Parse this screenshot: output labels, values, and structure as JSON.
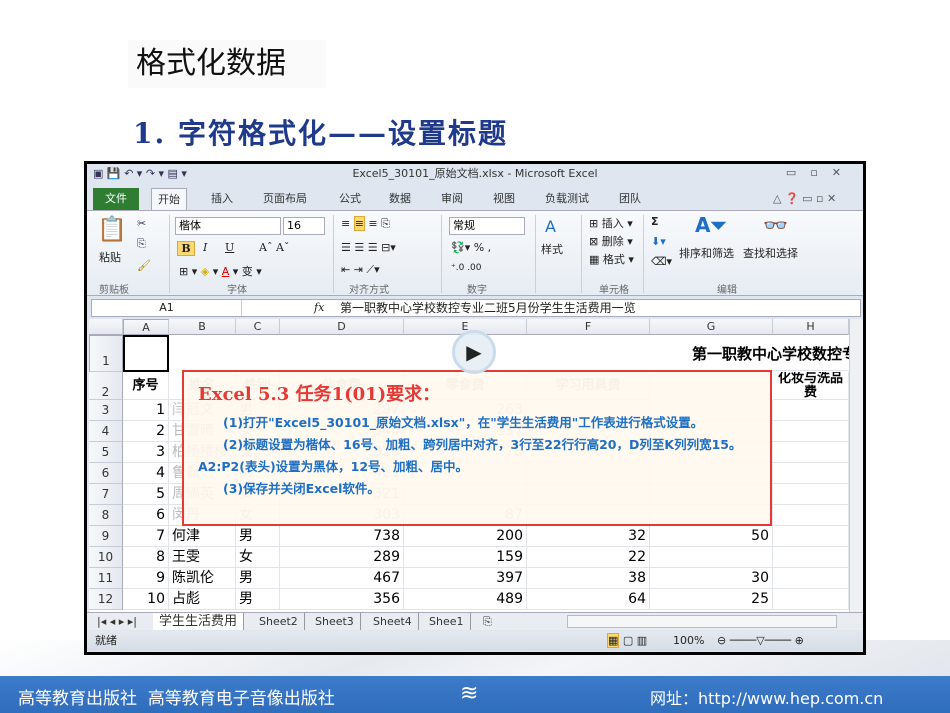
{
  "slide": {
    "title": "格式化数据",
    "subtitle": "1. 字符格式化——设置标题"
  },
  "footer": {
    "publisher_logo": "高等教育出版社",
    "publisher": "高等教育电子音像出版社",
    "website": "网址：http://www.hep.com.cn"
  },
  "excel": {
    "window_title": "Excel5_30101_原始文档.xlsx - Microsoft Excel",
    "tabs": [
      "文件",
      "开始",
      "插入",
      "页面布局",
      "公式",
      "数据",
      "审阅",
      "视图",
      "负载测试",
      "团队"
    ],
    "active_tab": "开始",
    "ribbon": {
      "paste": "粘贴",
      "font_name": "楷体",
      "font_size": "16",
      "bold": "B",
      "italic": "I",
      "underline": "U",
      "number_format": "常规",
      "percent": "%",
      "comma": ",",
      "styles": "样式",
      "insert": "插入",
      "delete": "删除",
      "format": "格式",
      "sort_filter": "排序和筛选",
      "find_select": "查找和选择",
      "sum": "Σ",
      "groups": [
        "剪贴板",
        "字体",
        "对齐方式",
        "数字",
        "单元格",
        "编辑"
      ]
    },
    "name_box": "A1",
    "fx": "fx",
    "formula": "第一职教中心学校数控专业二班5月份学生生活费用一览",
    "columns": [
      "A",
      "B",
      "C",
      "D",
      "E",
      "F",
      "G",
      "H"
    ],
    "title_cell": "第一职教中心学校数控专业二.",
    "headers": [
      "序号",
      "姓名",
      "性别",
      "伙食费",
      "零食费",
      "学习用具费",
      "",
      "化妆与洗品费"
    ],
    "rows": [
      {
        "r": "3",
        "c": [
          "1",
          "闫冠文",
          "男",
          "297",
          "263",
          "",
          ""
        ],
        "faded": true
      },
      {
        "r": "4",
        "c": [
          "2",
          "甘雪晴",
          "女",
          "340",
          "137",
          "",
          ""
        ],
        "faded": true
      },
      {
        "r": "5",
        "c": [
          "3",
          "柏杨楼楼",
          "女",
          "329",
          "78",
          "",
          ""
        ],
        "faded": true
      },
      {
        "r": "6",
        "c": [
          "4",
          "鲁磊",
          "男",
          "421",
          "",
          "",
          ""
        ],
        "faded": true
      },
      {
        "r": "7",
        "c": [
          "5",
          "周徜英",
          "女",
          "321",
          "",
          "",
          ""
        ],
        "faded": true
      },
      {
        "r": "8",
        "c": [
          "6",
          "闵丹",
          "女",
          "303",
          "87",
          "",
          ""
        ],
        "faded": true
      },
      {
        "r": "9",
        "c": [
          "7",
          "何津",
          "男",
          "738",
          "200",
          "32",
          "50"
        ]
      },
      {
        "r": "10",
        "c": [
          "8",
          "王雯",
          "女",
          "289",
          "159",
          "22",
          ""
        ]
      },
      {
        "r": "11",
        "c": [
          "9",
          "陈凯伦",
          "男",
          "467",
          "397",
          "38",
          "30"
        ]
      },
      {
        "r": "12",
        "c": [
          "10",
          "占彪",
          "男",
          "356",
          "489",
          "64",
          "25"
        ]
      }
    ],
    "popup": {
      "heading": "Excel 5.3 任务1(01)要求：",
      "items": [
        "(1)打开\"Excel5_30101_原始文档.xlsx\"，在\"学生生活费用\"工作表进行格式设置。",
        "(2)标题设置为楷体、16号、加粗、跨列居中对齐，3行至22行行高20，D列至K列列宽15。A2:P2(表头)设置为黑体，12号、加粗、居中。",
        "(3)保存并关闭Excel软件。"
      ]
    },
    "sheet_tabs": [
      "学生生活费用",
      "Sheet2",
      "Sheet3",
      "Sheet4",
      "Shee1"
    ],
    "status": "就绪",
    "zoom": "100%"
  }
}
